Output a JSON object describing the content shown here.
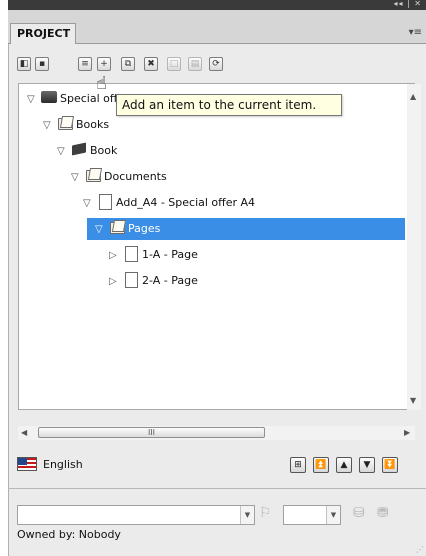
{
  "window": {
    "title_buttons": "◂◂ | ✕"
  },
  "tabs": [
    {
      "label": "PROJECT"
    }
  ],
  "panel_menu_icon": "panel-menu-icon",
  "toolbar": {
    "buttons": [
      {
        "icon": "select-icon",
        "glyph": "◧"
      },
      {
        "icon": "save-icon",
        "glyph": "▪"
      },
      {
        "icon": "properties-icon",
        "glyph": "≡"
      },
      {
        "icon": "add-item-icon",
        "glyph": "+"
      },
      {
        "icon": "copy-icon",
        "glyph": "⧉"
      },
      {
        "icon": "delete-icon",
        "glyph": "✖"
      },
      {
        "icon": "blank-icon",
        "glyph": "□"
      },
      {
        "icon": "list-icon",
        "glyph": "▤"
      },
      {
        "icon": "refresh-icon",
        "glyph": "⟳"
      }
    ]
  },
  "tooltip": {
    "text": "Add an item to the current item."
  },
  "tree": {
    "items": [
      {
        "label": "Special offer",
        "icon": "special-icon",
        "level": 0,
        "expanded": true
      },
      {
        "label": "Books",
        "icon": "folder-icon",
        "level": 1,
        "expanded": true
      },
      {
        "label": "Book",
        "icon": "book-icon",
        "level": 2,
        "expanded": true
      },
      {
        "label": "Documents",
        "icon": "folder-icon",
        "level": 3,
        "expanded": true
      },
      {
        "label": "Add_A4 - Special offer A4",
        "icon": "page-icon",
        "level": 4,
        "expanded": true
      },
      {
        "label": "Pages",
        "icon": "folder-icon",
        "level": 5,
        "expanded": true,
        "selected": true
      },
      {
        "label": "1-A - Page",
        "icon": "page-icon",
        "level": 6,
        "expanded": false
      },
      {
        "label": "2-A - Page",
        "icon": "page-icon",
        "level": 6,
        "expanded": false
      }
    ]
  },
  "hscroll": {
    "thumb_glyph": "III"
  },
  "language": {
    "label": "English",
    "flag": "us-flag-icon"
  },
  "nav_buttons": [
    {
      "icon": "expand-tree-icon",
      "glyph": "⊞"
    },
    {
      "icon": "move-top-icon",
      "glyph": "⏫"
    },
    {
      "icon": "move-up-icon",
      "glyph": "▲"
    },
    {
      "icon": "move-down-icon",
      "glyph": "▼"
    },
    {
      "icon": "move-bottom-icon",
      "glyph": "⏬"
    }
  ],
  "bottom": {
    "owner_label": "Owned by: Nobody",
    "combo1_value": "",
    "combo2_value": ""
  },
  "colors": {
    "selection": "#3a8ee6",
    "tooltip_bg": "#ffffe1",
    "titlebar": "#3a3a3a"
  }
}
